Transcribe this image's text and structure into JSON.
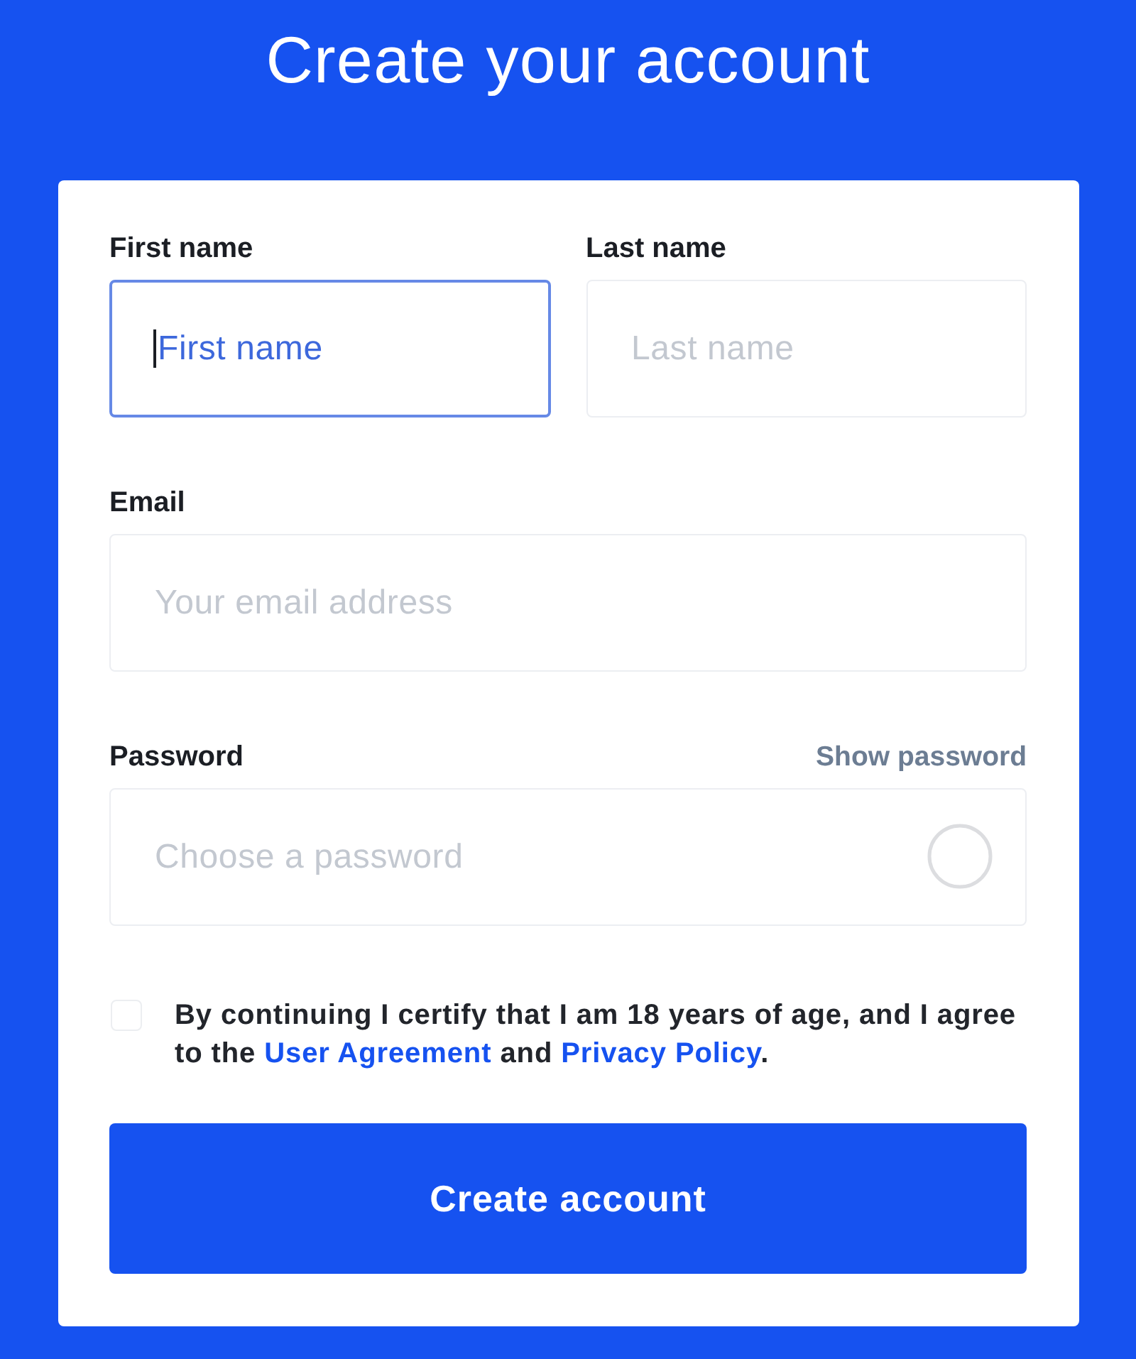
{
  "title": "Create your account",
  "name_fields": [
    {
      "label": "First name",
      "placeholder": "First name",
      "focused": true
    },
    {
      "label": "Last name",
      "placeholder": "Last name",
      "focused": false
    }
  ],
  "email": {
    "label": "Email",
    "placeholder": "Your email address",
    "focused": false
  },
  "password": {
    "label": "Password",
    "toggle": "Show password",
    "placeholder": "Choose a password",
    "focused": false
  },
  "agreement": {
    "checked": false,
    "parts": [
      {
        "kind": "text",
        "text": "By continuing I certify that I am 18 years of age, and I agree to the "
      },
      {
        "kind": "link",
        "text": "User Agreement"
      },
      {
        "kind": "text",
        "text": " and "
      },
      {
        "kind": "link",
        "text": "Privacy Policy"
      },
      {
        "kind": "text",
        "text": "."
      }
    ]
  },
  "submit": {
    "label": "Create account"
  }
}
